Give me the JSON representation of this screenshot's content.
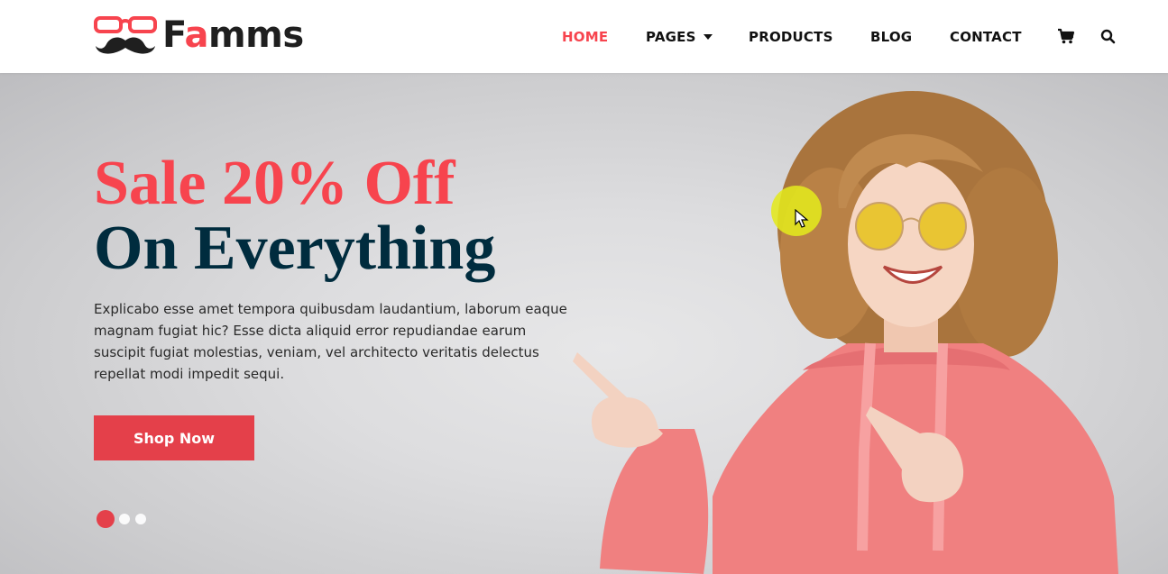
{
  "brand": {
    "name_prefix": "F",
    "name_accent": "a",
    "name_suffix": "mms",
    "accent_color": "#f7444e"
  },
  "nav": {
    "home": "HOME",
    "pages": "PAGES",
    "products": "PRODUCTS",
    "blog": "BLOG",
    "contact": "CONTACT",
    "cart_icon": "cart-icon",
    "search_icon": "search-icon"
  },
  "hero": {
    "title_line1": "Sale 20% Off",
    "title_line2": "On Everything",
    "description": "Explicabo esse amet tempora quibusdam laudantium, laborum eaque magnam fugiat hic? Esse dicta aliquid error repudiandae earum suscipit fugiat molestias, veniam, vel architecto veritatis delectus repellat modi impedit sequi.",
    "cta_label": "Shop Now",
    "slides_total": 3,
    "slide_active": 1
  },
  "colors": {
    "accent": "#f7444e",
    "button": "#e4404a",
    "heading_dark": "#002c3e"
  }
}
